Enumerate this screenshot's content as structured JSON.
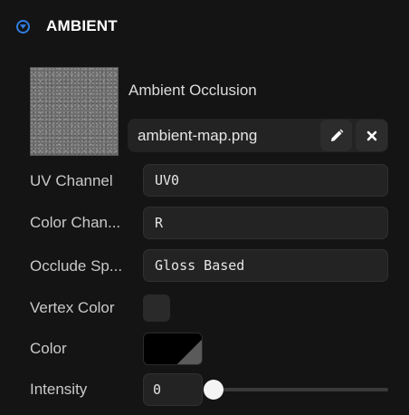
{
  "section": {
    "title": "AMBIENT",
    "toggle_icon": "chevron-down-circle-icon",
    "accent_color": "#2f7de1"
  },
  "asset": {
    "label": "Ambient Occlusion",
    "filename": "ambient-map.png",
    "edit_icon": "pencil-icon",
    "clear_icon": "close-icon"
  },
  "properties": {
    "uv_channel": {
      "label": "UV Channel",
      "value": "UV0"
    },
    "color_channel": {
      "label": "Color Chan...",
      "value": "R"
    },
    "occlude_specular": {
      "label": "Occlude Sp...",
      "value": "Gloss Based"
    },
    "vertex_color": {
      "label": "Vertex Color",
      "checked": false
    },
    "color": {
      "label": "Color",
      "value": "#000000"
    },
    "intensity": {
      "label": "Intensity",
      "value": "0",
      "slider_fraction": 0
    }
  }
}
